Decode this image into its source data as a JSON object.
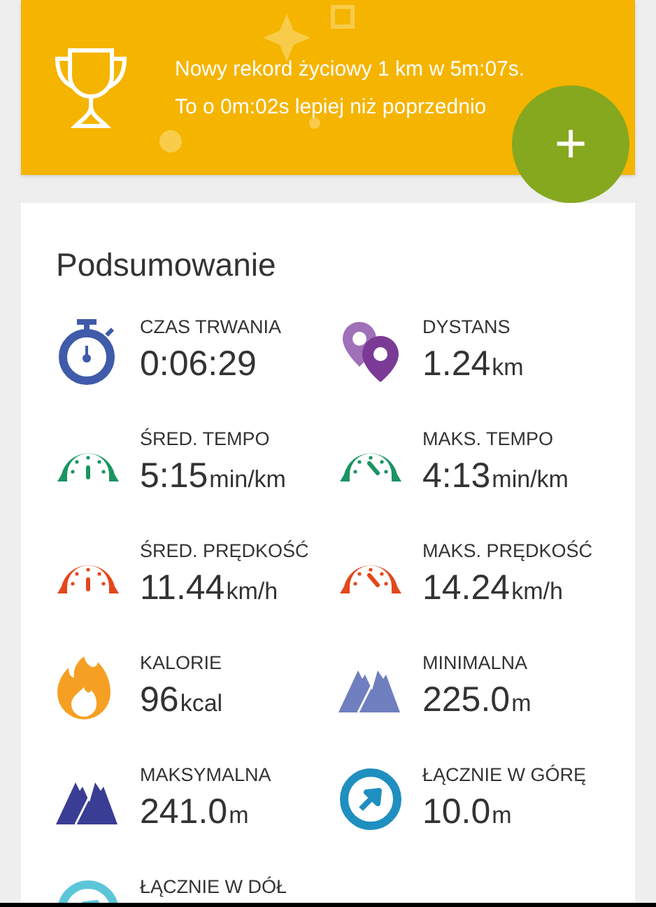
{
  "banner": {
    "lines": [
      "Nowy rekord życiowy 1 km w 5m:07s.",
      "To o 0m:02s lepiej niż poprzednio"
    ]
  },
  "fab": {
    "label": "+"
  },
  "summary": {
    "title": "Podsumowanie",
    "stats": [
      {
        "label": "CZAS TRWANIA",
        "value": "0:06:29",
        "kind": "stopwatch",
        "color": "#3f5ba9"
      },
      {
        "label": "DYSTANS",
        "value": "1.24",
        "unit": "km",
        "kind": "pins",
        "color": "#7b3a96"
      },
      {
        "label": "ŚRED. TEMPO",
        "value": "5:15",
        "unit": "min/km",
        "kind": "gauge-avg",
        "color": "#1a9463"
      },
      {
        "label": "MAKS. TEMPO",
        "value": "4:13",
        "unit": "min/km",
        "kind": "gauge-max",
        "color": "#1a9463"
      },
      {
        "label": "ŚRED. PRĘDKOŚĆ",
        "value": "11.44",
        "unit": "km/h",
        "kind": "gauge-avg",
        "color": "#e2481c"
      },
      {
        "label": "MAKS. PRĘDKOŚĆ",
        "value": "14.24",
        "unit": "km/h",
        "kind": "gauge-max",
        "color": "#e2481c"
      },
      {
        "label": "KALORIE",
        "value": "96",
        "unit": "kcal",
        "kind": "flame",
        "color": "#f5a023"
      },
      {
        "label": "MINIMALNA",
        "value": "225.0",
        "unit": "m",
        "kind": "mountains",
        "color": "#6f7fbf"
      },
      {
        "label": "MAKSYMALNA",
        "value": "241.0",
        "unit": "m",
        "kind": "mountains",
        "color": "#3a3d94"
      },
      {
        "label": "ŁĄCZNIE W GÓRĘ",
        "value": "10.0",
        "unit": "m",
        "kind": "arrow-circle",
        "color": "#1f8fc0"
      },
      {
        "label": "ŁĄCZNIE W DÓŁ",
        "kind": "arrow-circle",
        "color": "#5cc6d9"
      }
    ]
  }
}
